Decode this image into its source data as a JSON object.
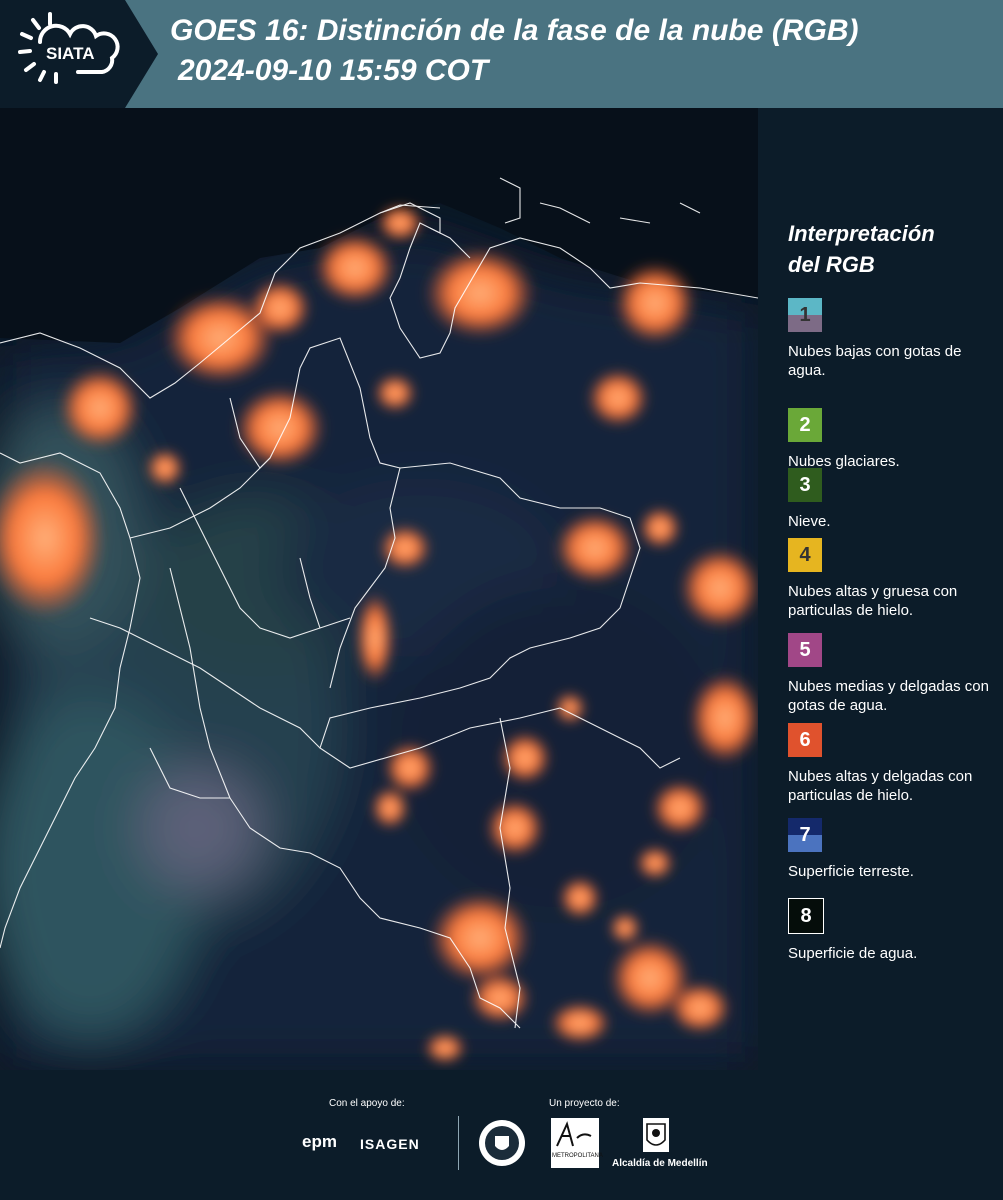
{
  "header": {
    "logo_text": "SIATA",
    "title_line1": "GOES 16: Distinción de la fase de la nube (RGB)",
    "title_line2": "2024-09-10 15:59 COT"
  },
  "legend": {
    "title_line1": "Interpretación",
    "title_line2": "del RGB",
    "items": [
      {
        "num": "1",
        "label": "Nubes bajas con gotas de agua.",
        "color_top": "#5cb7c6",
        "color_bottom": "#7d6b86"
      },
      {
        "num": "2",
        "label": "Nubes glaciares.",
        "color_top": "#6aa838",
        "color_bottom": "#6aa838"
      },
      {
        "num": "3",
        "label": "Nieve.",
        "color_top": "#2f5c1e",
        "color_bottom": "#2f5c1e"
      },
      {
        "num": "4",
        "label": "Nubes altas y gruesa con particulas de hielo.",
        "color_top": "#e6b520",
        "color_bottom": "#e6b520"
      },
      {
        "num": "5",
        "label": "Nubes medias y delgadas con gotas de agua.",
        "color_top": "#a14787",
        "color_bottom": "#a14787"
      },
      {
        "num": "6",
        "label": "Nubes altas y delgadas con particulas de hielo.",
        "color_top": "#e0522d",
        "color_bottom": "#e0522d"
      },
      {
        "num": "7",
        "label": "Superficie terreste.",
        "color_top": "#14296b",
        "color_bottom": "#4b73bf"
      },
      {
        "num": "8",
        "label": "Superficie de agua.",
        "color_top": "#050d0a",
        "color_bottom": "#050d0a"
      }
    ]
  },
  "footer": {
    "support_label": "Con el apoyo de:",
    "project_label": "Un proyecto de:",
    "sponsor1": "epm",
    "sponsor2": "ISAGEN",
    "partner1": "METROPOLITANA",
    "partner2": "Alcaldía de Medellín"
  }
}
